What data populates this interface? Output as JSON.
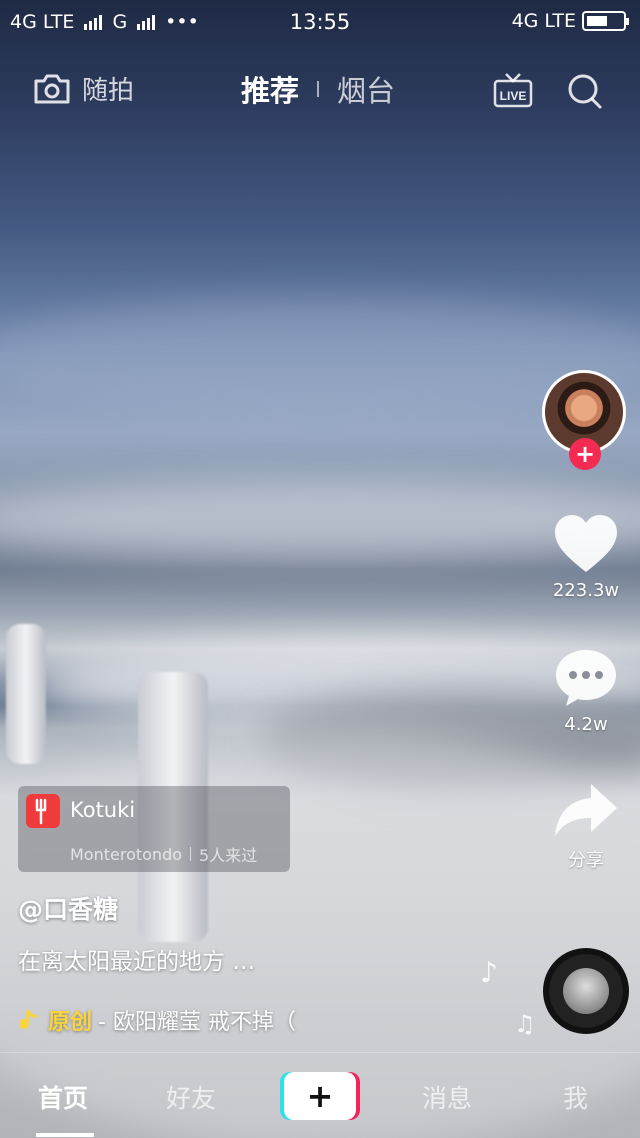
{
  "status_bar": {
    "left_network_1": "4G LTE",
    "left_network_2": "G",
    "more": "•••",
    "time": "13:55",
    "right_network": "4G LTE",
    "battery_level": 0.55
  },
  "top_nav": {
    "camera_label": "随拍",
    "tab_recommend": "推荐",
    "tab_local": "烟台",
    "live_icon": "live-tv-icon",
    "search_icon": "search-icon"
  },
  "actions": {
    "like_count": "223.3w",
    "comment_count": "4.2w",
    "share_label": "分享"
  },
  "poi": {
    "name": "Kotuki",
    "location": "Monterotondo",
    "visitors": "5人来过"
  },
  "post": {
    "username": "@口香糖",
    "caption": "在离太阳最近的地方 …",
    "music_tag": "原创",
    "music_text": " - 欧阳耀莹    戒不掉（"
  },
  "bottom_nav": {
    "home": "首页",
    "friends": "好友",
    "create": "+",
    "messages": "消息",
    "me": "我"
  },
  "colors": {
    "accent_red": "#f42a53",
    "music_yellow": "#fbd43a",
    "create_cyan": "#2be2e8",
    "create_pink": "#f2245a"
  }
}
